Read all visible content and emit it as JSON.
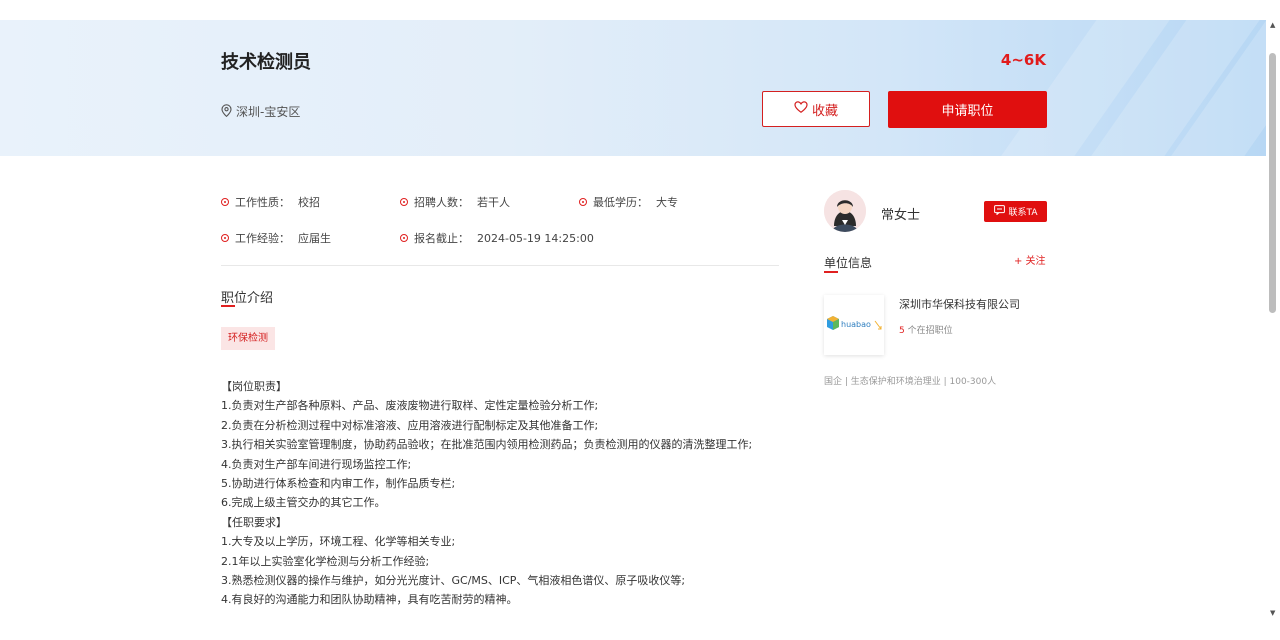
{
  "job": {
    "title": "技术检测员",
    "salary": "4~6K",
    "location": "深圳-宝安区",
    "favorite_label": "收藏",
    "apply_label": "申请职位"
  },
  "details": [
    {
      "label": "工作性质：",
      "value": "校招"
    },
    {
      "label": "招聘人数：",
      "value": "若干人"
    },
    {
      "label": "最低学历：",
      "value": "大专"
    },
    {
      "label": "工作经验：",
      "value": "应届生"
    },
    {
      "label": "报名截止：",
      "value": "2024-05-19 14:25:00"
    }
  ],
  "intro": {
    "title": "职位介绍",
    "tag": "环保检测",
    "lines": [
      "【岗位职责】",
      "1.负责对生产部各种原料、产品、废液废物进行取样、定性定量检验分析工作;",
      "2.负责在分析检测过程中对标准溶液、应用溶液进行配制标定及其他准备工作;",
      "3.执行相关实验室管理制度，协助药品验收；在批准范围内领用检测药品；负责检测用的仪器的清洗整理工作;",
      "4.负责对生产部车间进行现场监控工作;",
      "5.协助进行体系检查和内审工作，制作品质专栏;",
      "6.完成上级主管交办的其它工作。",
      "【任职要求】",
      "1.大专及以上学历，环境工程、化学等相关专业;",
      "2.1年以上实验室化学检测与分析工作经验;",
      "3.熟悉检测仪器的操作与维护，如分光光度计、GC/MS、ICP、气相液相色谱仪、原子吸收仪等;",
      "4.有良好的沟通能力和团队协助精神，具有吃苦耐劳的精神。"
    ]
  },
  "contact": {
    "name": "常女士",
    "button_label": "联系TA"
  },
  "organization": {
    "section_title": "单位信息",
    "follow_label": "+ 关注",
    "company_name": "深圳市华保科技有限公司",
    "logo_text": "huabao",
    "job_count": "5",
    "job_count_suffix": "个在招职位",
    "meta": "国企 | 生态保护和环境治理业 | 100-300人"
  },
  "colors": {
    "accent": "#e00f0f",
    "header_start": "#e9f2fb",
    "header_end": "#b7d7f4"
  },
  "icons": [
    "location-pin-icon",
    "heart-icon",
    "chat-icon",
    "scroll-up-icon",
    "scroll-down-icon"
  ]
}
